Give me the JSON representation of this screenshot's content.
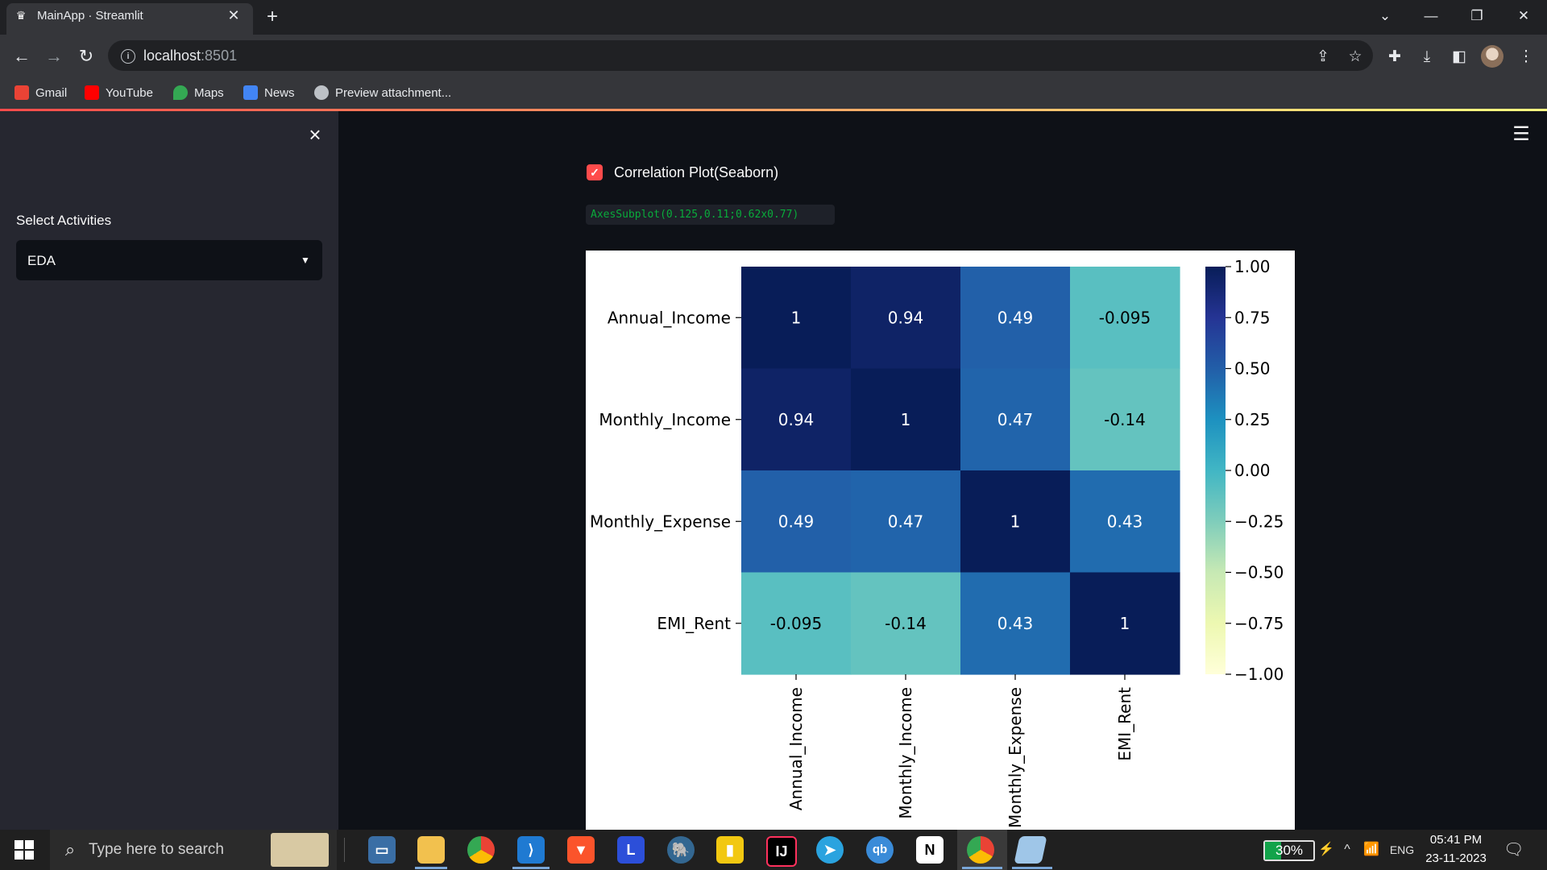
{
  "browser": {
    "tab_title": "MainApp · Streamlit",
    "url_host": "localhost",
    "url_port": ":8501",
    "bookmarks": [
      {
        "label": "Gmail",
        "icon": "gmail-icon",
        "color": "#ea4335"
      },
      {
        "label": "YouTube",
        "icon": "youtube-icon",
        "color": "#ff0000"
      },
      {
        "label": "Maps",
        "icon": "maps-icon",
        "color": "#34a853"
      },
      {
        "label": "News",
        "icon": "news-icon",
        "color": "#4285f4"
      },
      {
        "label": "Preview attachment...",
        "icon": "globe-icon",
        "color": "#bdc1c6"
      }
    ]
  },
  "sidebar": {
    "select_label": "Select Activities",
    "selected_value": "EDA"
  },
  "main": {
    "checkbox_label": "Correlation Plot(Seaborn)",
    "checkbox_checked": true,
    "code_output": "AxesSubplot(0.125,0.11;0.62x0.77)"
  },
  "chart_data": {
    "type": "heatmap",
    "title": "",
    "row_labels": [
      "Annual_Income",
      "Monthly_Income",
      "Monthly_Expense",
      "EMI_Rent"
    ],
    "col_labels": [
      "Annual_Income",
      "Monthly_Income",
      "Monthly_Expense",
      "EMI_Rent"
    ],
    "cell_labels": [
      [
        "1",
        "0.94",
        "0.49",
        "-0.095"
      ],
      [
        "0.94",
        "1",
        "0.47",
        "-0.14"
      ],
      [
        "0.49",
        "0.47",
        "1",
        "0.43"
      ],
      [
        "-0.095",
        "-0.14",
        "0.43",
        "1"
      ]
    ],
    "values": [
      [
        1,
        0.94,
        0.49,
        -0.095
      ],
      [
        0.94,
        1,
        0.47,
        -0.14
      ],
      [
        0.49,
        0.47,
        1,
        0.43
      ],
      [
        -0.095,
        -0.14,
        0.43,
        1
      ]
    ],
    "colormap": "YlGnBu",
    "vmin": -1,
    "vmax": 1,
    "colorbar_ticks": [
      "1.00",
      "0.75",
      "0.50",
      "0.25",
      "0.00",
      "−0.25",
      "−0.50",
      "−0.75",
      "−1.00"
    ],
    "cmap_stops": [
      "#ffffd9",
      "#edf8b1",
      "#c7e9b4",
      "#7fcdbb",
      "#41b6c4",
      "#1d91c0",
      "#225ea8",
      "#253494",
      "#081d58"
    ]
  },
  "taskbar": {
    "search_placeholder": "Type here to search",
    "battery": "30%",
    "language": "ENG",
    "time": "05:41 PM",
    "date": "23-11-2023",
    "apps": [
      "file-manager-icon",
      "folder-icon",
      "chrome-icon",
      "vscode-icon",
      "brave-icon",
      "l-app-icon",
      "postgres-icon",
      "powerbi-icon",
      "intellij-icon",
      "telegram-icon",
      "qbittorrent-icon",
      "notion-icon",
      "chrome-active-icon",
      "app-icon"
    ]
  }
}
